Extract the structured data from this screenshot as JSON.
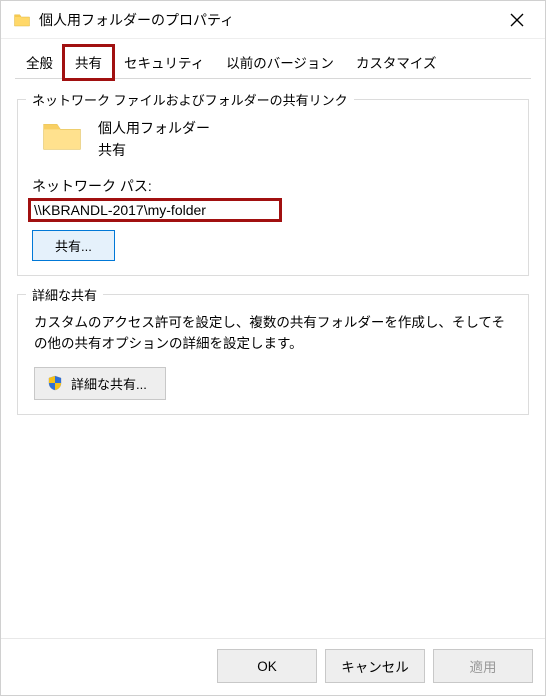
{
  "window": {
    "title": "個人用フォルダーのプロパティ"
  },
  "tabs": {
    "general": "全般",
    "sharing": "共有",
    "security": "セキュリティ",
    "previous_versions": "以前のバージョン",
    "customize": "カスタマイズ",
    "selected": "sharing",
    "highlighted": "sharing"
  },
  "sharing_group": {
    "legend": "ネットワーク ファイルおよびフォルダーの共有リンク",
    "folder_name": "個人用フォルダー",
    "folder_state": "共有",
    "network_path_label": "ネットワーク パス:",
    "network_path": "\\\\KBRANDL-2017\\my-folder",
    "share_button": "共有..."
  },
  "advanced_group": {
    "legend": "詳細な共有",
    "description": "カスタムのアクセス許可を設定し、複数の共有フォルダーを作成し、そしてその他の共有オプションの詳細を設定します。",
    "button": "詳細な共有..."
  },
  "footer": {
    "ok": "OK",
    "cancel": "キャンセル",
    "apply": "適用"
  }
}
